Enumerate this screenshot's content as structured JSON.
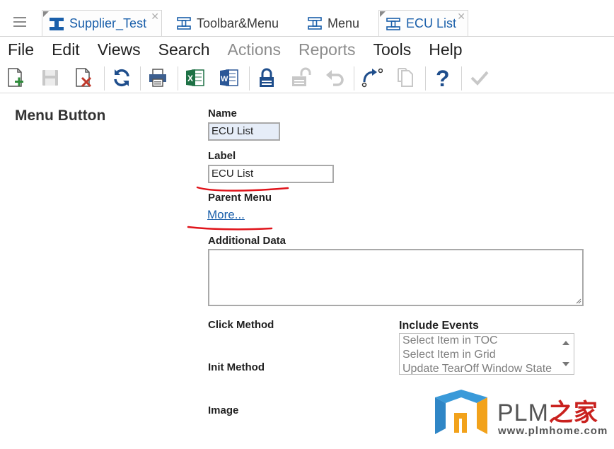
{
  "tabs": [
    {
      "label": "Supplier_Test",
      "icon": "item-type-icon"
    },
    {
      "label": "Toolbar&Menu",
      "icon": "item-type-icon"
    },
    {
      "label": "Menu",
      "icon": "item-type-icon"
    },
    {
      "label": "ECU List",
      "icon": "item-type-icon"
    }
  ],
  "menubar": [
    {
      "label": "File"
    },
    {
      "label": "Edit"
    },
    {
      "label": "Views"
    },
    {
      "label": "Search"
    },
    {
      "label": "Actions",
      "disabled": true
    },
    {
      "label": "Reports",
      "disabled": true
    },
    {
      "label": "Tools"
    },
    {
      "label": "Help"
    }
  ],
  "toolbar": {
    "icons": [
      "new-icon",
      "save-icon",
      "discard-icon",
      "refresh-icon",
      "print-icon",
      "excel-icon",
      "word-icon",
      "lock-icon",
      "unlock-icon",
      "undo-icon",
      "promote-icon",
      "copy-icon",
      "help-icon",
      "done-icon"
    ]
  },
  "form": {
    "title": "Menu Button",
    "name_label": "Name",
    "name_value": "ECU List",
    "label_label": "Label",
    "label_value": "ECU List",
    "parent_menu_label": "Parent Menu",
    "parent_menu_link": "More...",
    "additional_data_label": "Additional Data",
    "click_method_label": "Click Method",
    "init_method_label": "Init Method",
    "image_label": "Image",
    "include_events_label": "Include Events",
    "include_events_options": [
      "Select Item in TOC",
      "Select Item in Grid",
      "Update TearOff Window State"
    ]
  },
  "watermark": {
    "title": "PLM",
    "title_cn": "之家",
    "url": "www.plmhome.com"
  },
  "colors": {
    "accent": "#1a5faa",
    "annotation": "#e0141b",
    "readonly_field": "#e6edf8"
  }
}
